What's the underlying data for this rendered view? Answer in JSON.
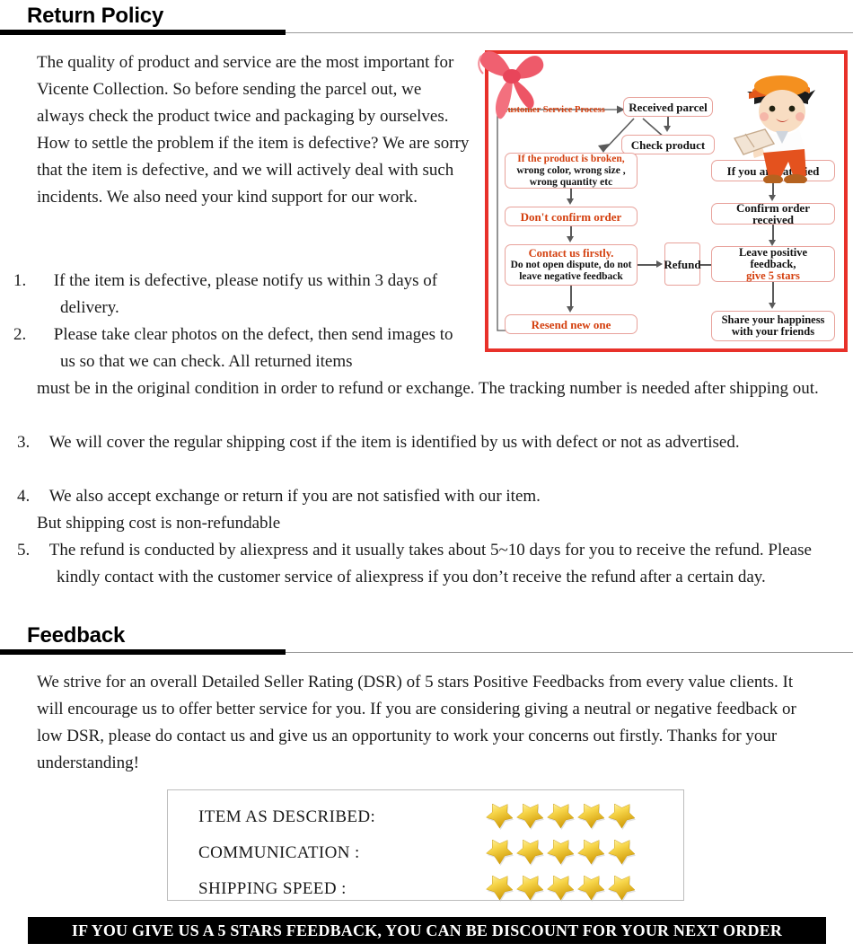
{
  "sections": {
    "return_policy": {
      "title": "Return Policy"
    },
    "feedback": {
      "title": "Feedback"
    }
  },
  "return_policy_text": {
    "intro_col": "The quality of product and service are the most important for Vicente Collection. So before sending the parcel out, we always check the product twice and packaging by ourselves.\nHow to settle the problem if the item is defective? We are sorry that the item is defective, and we will actively deal with such incidents. We also need your kind support for our work.",
    "item1_num": "1.",
    "item1": "If the item is defective, please notify us within 3 days of delivery.",
    "item2_num": "2.",
    "item2_col": "Please take clear photos on the defect, then send images to us so that we can check. All returned items",
    "item2_full": "must be in the original condition in order to refund or exchange. The tracking number is needed after shipping out.",
    "item3_num": "3.",
    "item3": "We will cover the regular shipping cost if the item is identified by us with defect or not as advertised.",
    "item4_num": "4.",
    "item4": "We also accept exchange or return if you are not satisfied with our item.",
    "item4_extra": "But shipping cost is non-refundable",
    "item5_num": "5.",
    "item5": "The refund is conducted by aliexpress and it usually takes about 5~10 days for you to receive the refund. Please kindly contact with the customer service of aliexpress if you don’t receive the refund after a certain day."
  },
  "feedback_text": {
    "paragraph": "We strive for an overall Detailed Seller Rating (DSR) of 5 stars Positive Feedbacks from every value clients. It will encourage us to offer better service for you. If you are considering giving a neutral or negative feedback or low DSR, please do contact us and give us an opportunity to work your concerns out firstly. Thanks for your understanding!"
  },
  "ratings": {
    "rows": [
      {
        "label": "ITEM AS DESCRIBED:",
        "stars": 5
      },
      {
        "label": "COMMUNICATION :",
        "stars": 5
      },
      {
        "label": "SHIPPING SPEED :",
        "stars": 5
      }
    ],
    "star_color": "#f5c518",
    "star_count": 5
  },
  "banner": {
    "text": "IF YOU GIVE US A 5 STARS FEEDBACK, YOU CAN BE DISCOUNT FOR YOUR NEXT ORDER",
    "background": "#000000",
    "color": "#ffffff"
  },
  "flowchart": {
    "frame_color": "#e8312a",
    "title": "Customer Service Process",
    "title_color": "#d4400f",
    "box_border_color": "#e8a29b",
    "boxes": {
      "received_parcel": "Received parcel",
      "check_product": "Check product",
      "broken_line1": "If the product is broken,",
      "broken_line2": "wrong color, wrong size ,",
      "broken_line3": "wrong quantity etc",
      "dont_confirm": "Don't confirm order",
      "contact_line1": "Contact us firstly.",
      "contact_line2": "Do not open dispute, do not",
      "contact_line3": "leave negative feedback",
      "resend": "Resend new one",
      "refund": "Refund",
      "satisfied": "If you are satisfied",
      "confirm_received": "Confirm order received",
      "leave_feedback_line1": "Leave positive feedback,",
      "leave_feedback_line2": "give 5 stars",
      "share_line1": "Share your happiness",
      "share_line2": "with your friends"
    },
    "decorations": {
      "bow": "ribbon-bow-graphic",
      "courier": "delivery-person-graphic"
    }
  }
}
